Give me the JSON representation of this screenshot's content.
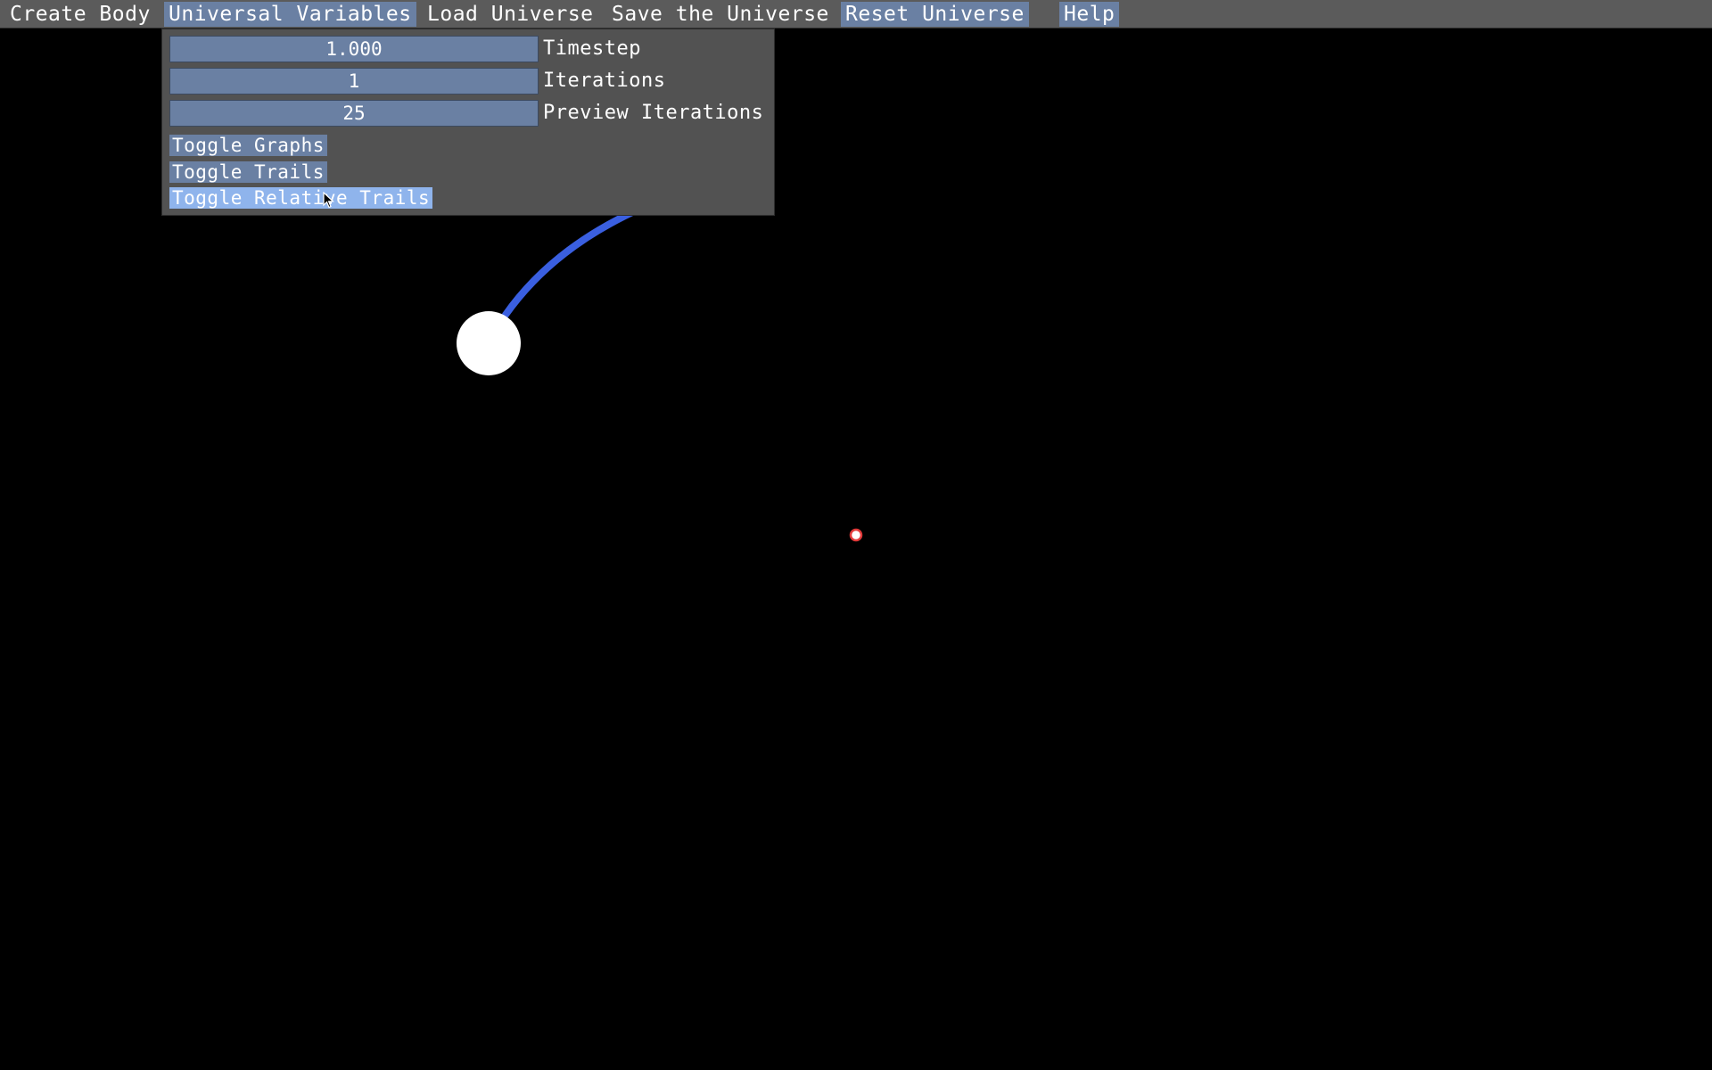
{
  "menubar": {
    "items": [
      {
        "label": "Create Body",
        "state": "normal"
      },
      {
        "label": "Universal Variables",
        "state": "open"
      },
      {
        "label": "Load Universe",
        "state": "normal"
      },
      {
        "label": "Save the Universe",
        "state": "normal"
      },
      {
        "label": "Reset Universe",
        "state": "highlighted"
      },
      {
        "label": "Help",
        "state": "highlighted"
      }
    ]
  },
  "dropdown": {
    "fields": [
      {
        "value": "1.000",
        "label": "Timestep"
      },
      {
        "value": "1",
        "label": "Iterations"
      },
      {
        "value": "25",
        "label": "Preview Iterations"
      }
    ],
    "toggles": [
      {
        "label": "Toggle Graphs",
        "hover": false
      },
      {
        "label": "Toggle Trails",
        "hover": false
      },
      {
        "label": "Toggle Relative Trails",
        "hover": true
      }
    ]
  },
  "colors": {
    "background": "#000000",
    "menubar": "#5b5b5b",
    "dropdown": "#525252",
    "field": "#6a80a3",
    "hover": "#8fb4ec",
    "trail": "#3a5fe0",
    "body_large": "#ffffff",
    "body_small_outline": "#e23a3a"
  },
  "icons": {
    "cursor": "arrow-cursor-icon"
  }
}
